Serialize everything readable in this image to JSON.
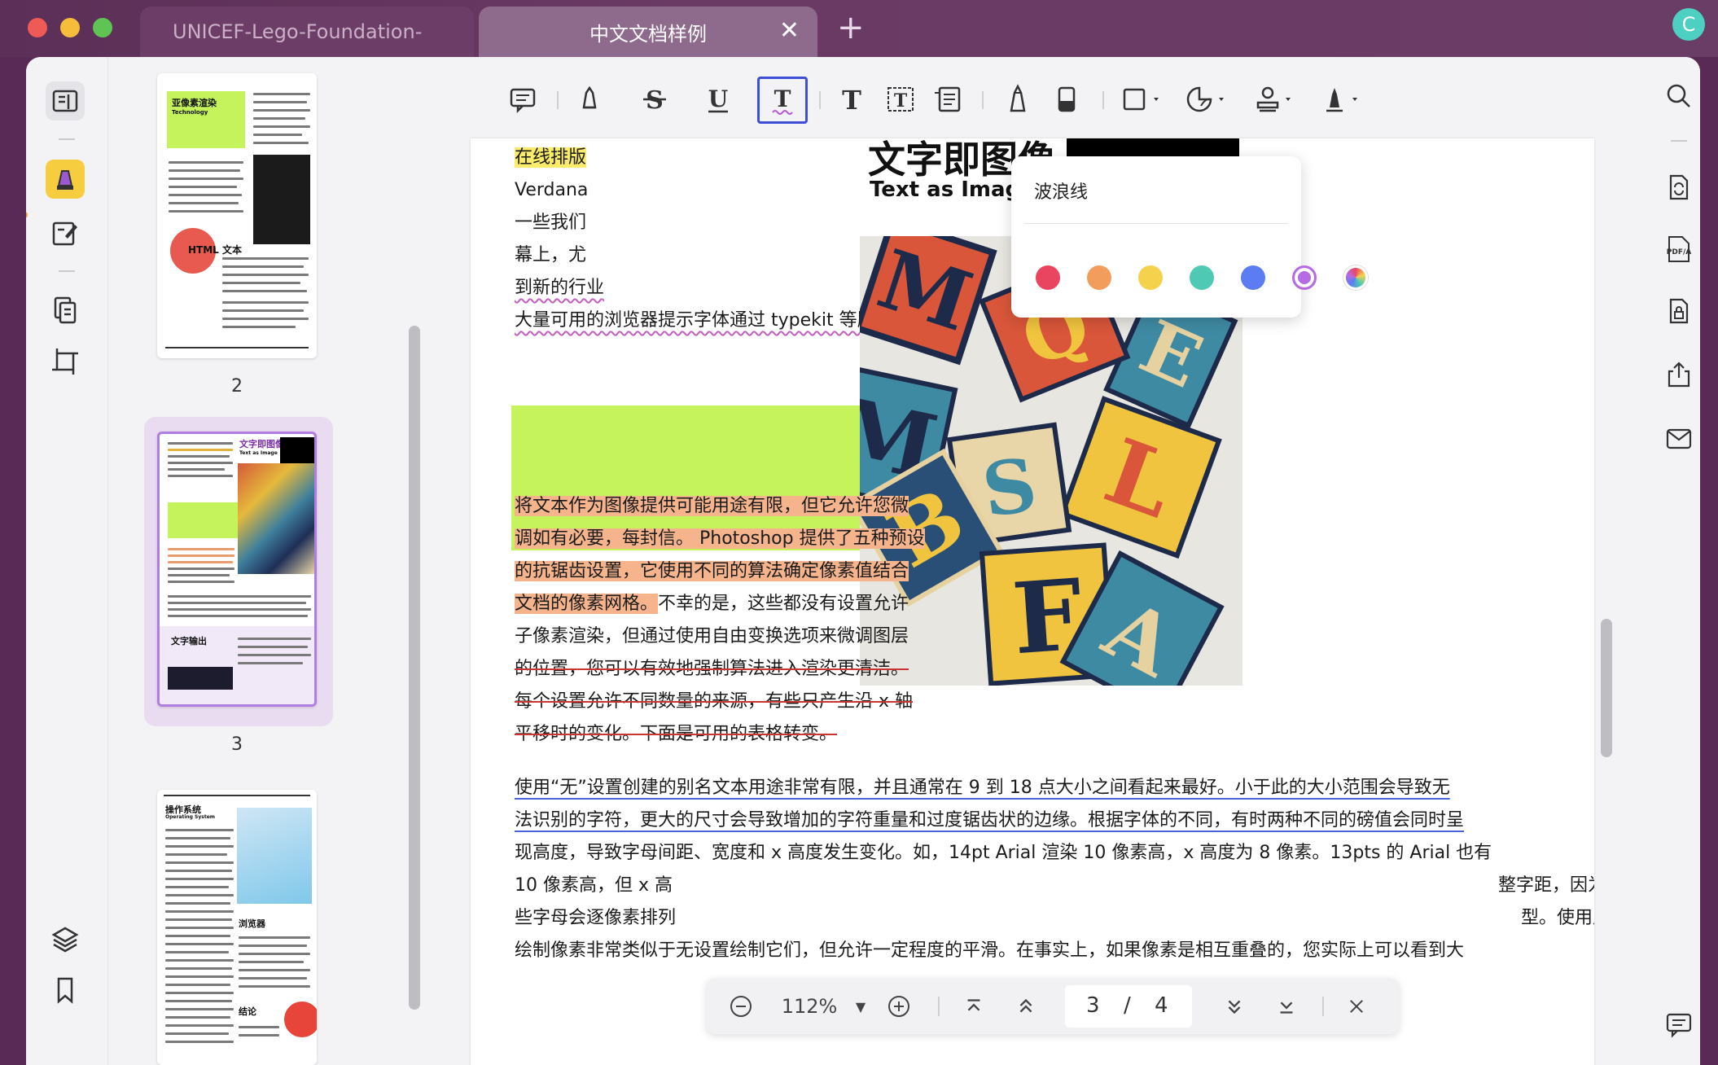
{
  "window": {
    "tabs": [
      {
        "label": "UNICEF-Lego-Foundation-"
      },
      {
        "label": "中文文档样例"
      }
    ],
    "close_tab_glyph": "✕",
    "new_tab_glyph": "+",
    "avatar_initial": "C"
  },
  "left_rail": {
    "items": [
      "reader-icon",
      "highlighter-icon",
      "edit-icon",
      "organize-pages-icon",
      "crop-icon",
      "layers-icon",
      "bookmark-icon"
    ]
  },
  "thumbnails": {
    "pages": [
      {
        "number": "2",
        "heading": "亚像素渲染",
        "heading_sub": "Technology",
        "badge": "HTML 文本"
      },
      {
        "number": "3",
        "heading": "文字即图像",
        "heading_sub": "Text as Image",
        "footer_heading": "文字输出"
      },
      {
        "number": "",
        "heading": "操作系统",
        "heading_sub": "Operating System",
        "side_heading": "浏览器",
        "footer_heading": "结论"
      }
    ]
  },
  "toolbar": {
    "tools": [
      "comment-icon",
      "highlight-icon",
      "strikethrough-icon",
      "underline-icon",
      "wavy-text-icon",
      "text-icon",
      "textbox-icon",
      "callout-icon",
      "pencil-icon",
      "eraser-icon",
      "shape-icon",
      "sticker-icon",
      "stamp-icon",
      "signature-icon"
    ]
  },
  "popover": {
    "title": "波浪线",
    "colors": [
      "#e94560",
      "#f29d5c",
      "#f5d24c",
      "#4ec9b4",
      "#5b7cf2",
      "#b66ae6",
      "#multi"
    ]
  },
  "document": {
    "title_image": "文字即图像",
    "subtitle_image": "Text as Image",
    "para1": [
      "在线排版",
      "Verdana",
      "一些我们",
      "幕上，尤",
      "到新的行业",
      "大量可用的浏览器提示字体通过 typekit 等服务。"
    ],
    "para2": [
      "将文本作为图像提供可能用途有限，但它允许您微",
      "调如有必要，每封信。 Photoshop 提供了五种预设",
      "的抗锯齿设置，它使用不同的算法确定像素值结合",
      "文档的像素网格。",
      "不幸的是，这些都没有设置允许",
      "子像素渲染，但通过使用自由变换选项来微调图层",
      "的位置，您可以有效地强制算法进入渲染更清洁。",
      "每个设置允许不同数量的来源，有些只产生沿 x 轴",
      "平移时的变化。下面是可用的表格转变。"
    ],
    "para3": [
      "使用“无”设置创建的别名文本用途非常有限，并且通常在 9 到 18 点大小之间看起来最好。小于此的大小范围会导致无",
      "法识别的字符，更大的尺寸会导致增加的字符重量和过度锯齿状的边缘。根据字体的不同，有时两种不同的磅值会同时呈",
      "现高度，导致字母间距、宽度和 x 高度发生变化。如，14pt Arial 渲染 10 像素高，x 高度为 8 像素。13pts 的 Arial 也有",
      "10 像素高，但 x 高",
      "整字距，因为有",
      "些字母会逐像素排列",
      "型。使用此设置",
      "绘制像素非常类似于无设置绘制它们，但允许一定程度的平滑。在事实上，如果像素是相互重叠的，您实际上可以看到大"
    ]
  },
  "navbar": {
    "zoom": "112%",
    "current_page": "3",
    "separator": "/",
    "total_pages": "4"
  },
  "right_rail": {
    "items": [
      "search-icon",
      "convert-icon",
      "pdfa-icon",
      "protect-icon",
      "share-icon",
      "mail-icon",
      "comments-icon"
    ],
    "pdfa_label": "PDF/A"
  }
}
